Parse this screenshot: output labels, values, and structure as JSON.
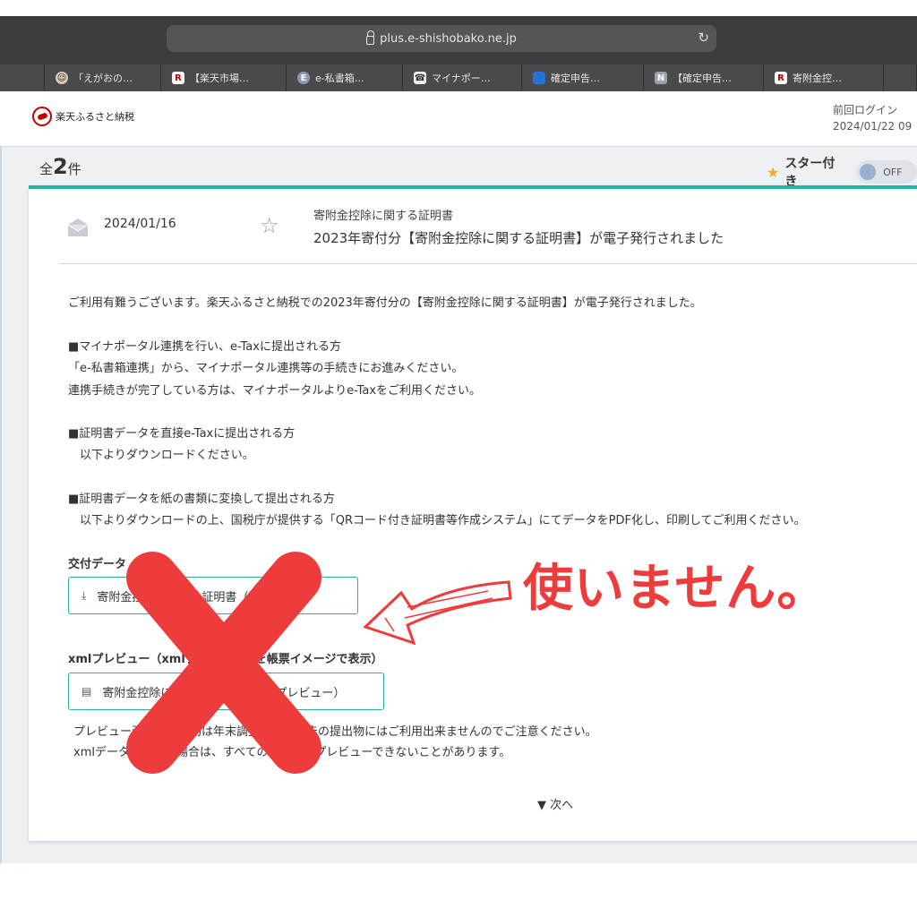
{
  "browser": {
    "url": "plus.e-shishobako.ne.jp",
    "tabs": [
      {
        "label": "",
        "favicon": "blank",
        "width": 50
      },
      {
        "label": "「えがおの…",
        "favicon": "face-icon",
        "width": 130
      },
      {
        "label": "【楽天市場…",
        "favicon": "R",
        "width": 140
      },
      {
        "label": "e-私書箱…",
        "favicon": "E",
        "width": 130
      },
      {
        "label": "マイナポー…",
        "favicon": "phone-icon",
        "width": 133
      },
      {
        "label": "確定申告…",
        "favicon": "person-icon",
        "width": 136
      },
      {
        "label": "【確定申告…",
        "favicon": "N",
        "width": 134
      },
      {
        "label": "寄附金控…",
        "favicon": "R",
        "width": 134
      },
      {
        "label": "",
        "favicon": "blank",
        "width": 37
      }
    ]
  },
  "header": {
    "logo_text": "楽天ふるさと納税",
    "last_login_label": "前回ログイン",
    "last_login_value": "2024/01/22 09"
  },
  "list": {
    "count_prefix": "全",
    "count": "2",
    "count_suffix": "件",
    "star_filter_label": "スター付き",
    "toggle_state": "OFF"
  },
  "message": {
    "date": "2024/01/16",
    "category": "寄附金控除に関する証明書",
    "title": "2023年寄付分【寄附金控除に関する証明書】が電子発行されました",
    "body_lines": [
      "ご利用有難うございます。楽天ふるさと納税での2023年寄付分の【寄附金控除に関する証明書】が電子発行されました。",
      "■マイナポータル連携を行い、e-Taxに提出される方",
      "「e-私書箱連携」から、マイナポータル連携等の手続きにお進みください。",
      "連携手続きが完了している方は、マイナポータルよりe-Taxをご利用ください。",
      "■証明書データを直接e-Taxに提出される方",
      "　以下よりダウンロードください。",
      "■証明書データを紙の書類に変換して提出される方",
      "　以下よりダウンロードの上、国税庁が提供する「QRコード付き証明書等作成システム」にてデータをPDF化し、印刷してご利用ください。"
    ],
    "download_heading": "交付データ",
    "download_button": "寄附金控除に関する証明書（データ）",
    "xml_heading": "xmlプレビュー（xmlデータの内容を帳票イメージで表示）",
    "xml_button": "寄附金控除に関する証明書（xmlプレビュー）",
    "notes": [
      "プレビュー画面の印刷物は年末調整や確定申告の提出物にはご利用出来ませんのでご注意ください。",
      "xmlデータが大量の場合は、すべてのページをプレビューできないことがあります。"
    ],
    "next_label": "次へ"
  },
  "annotation": {
    "text": "使いません。",
    "color": "#ee3b3b"
  }
}
